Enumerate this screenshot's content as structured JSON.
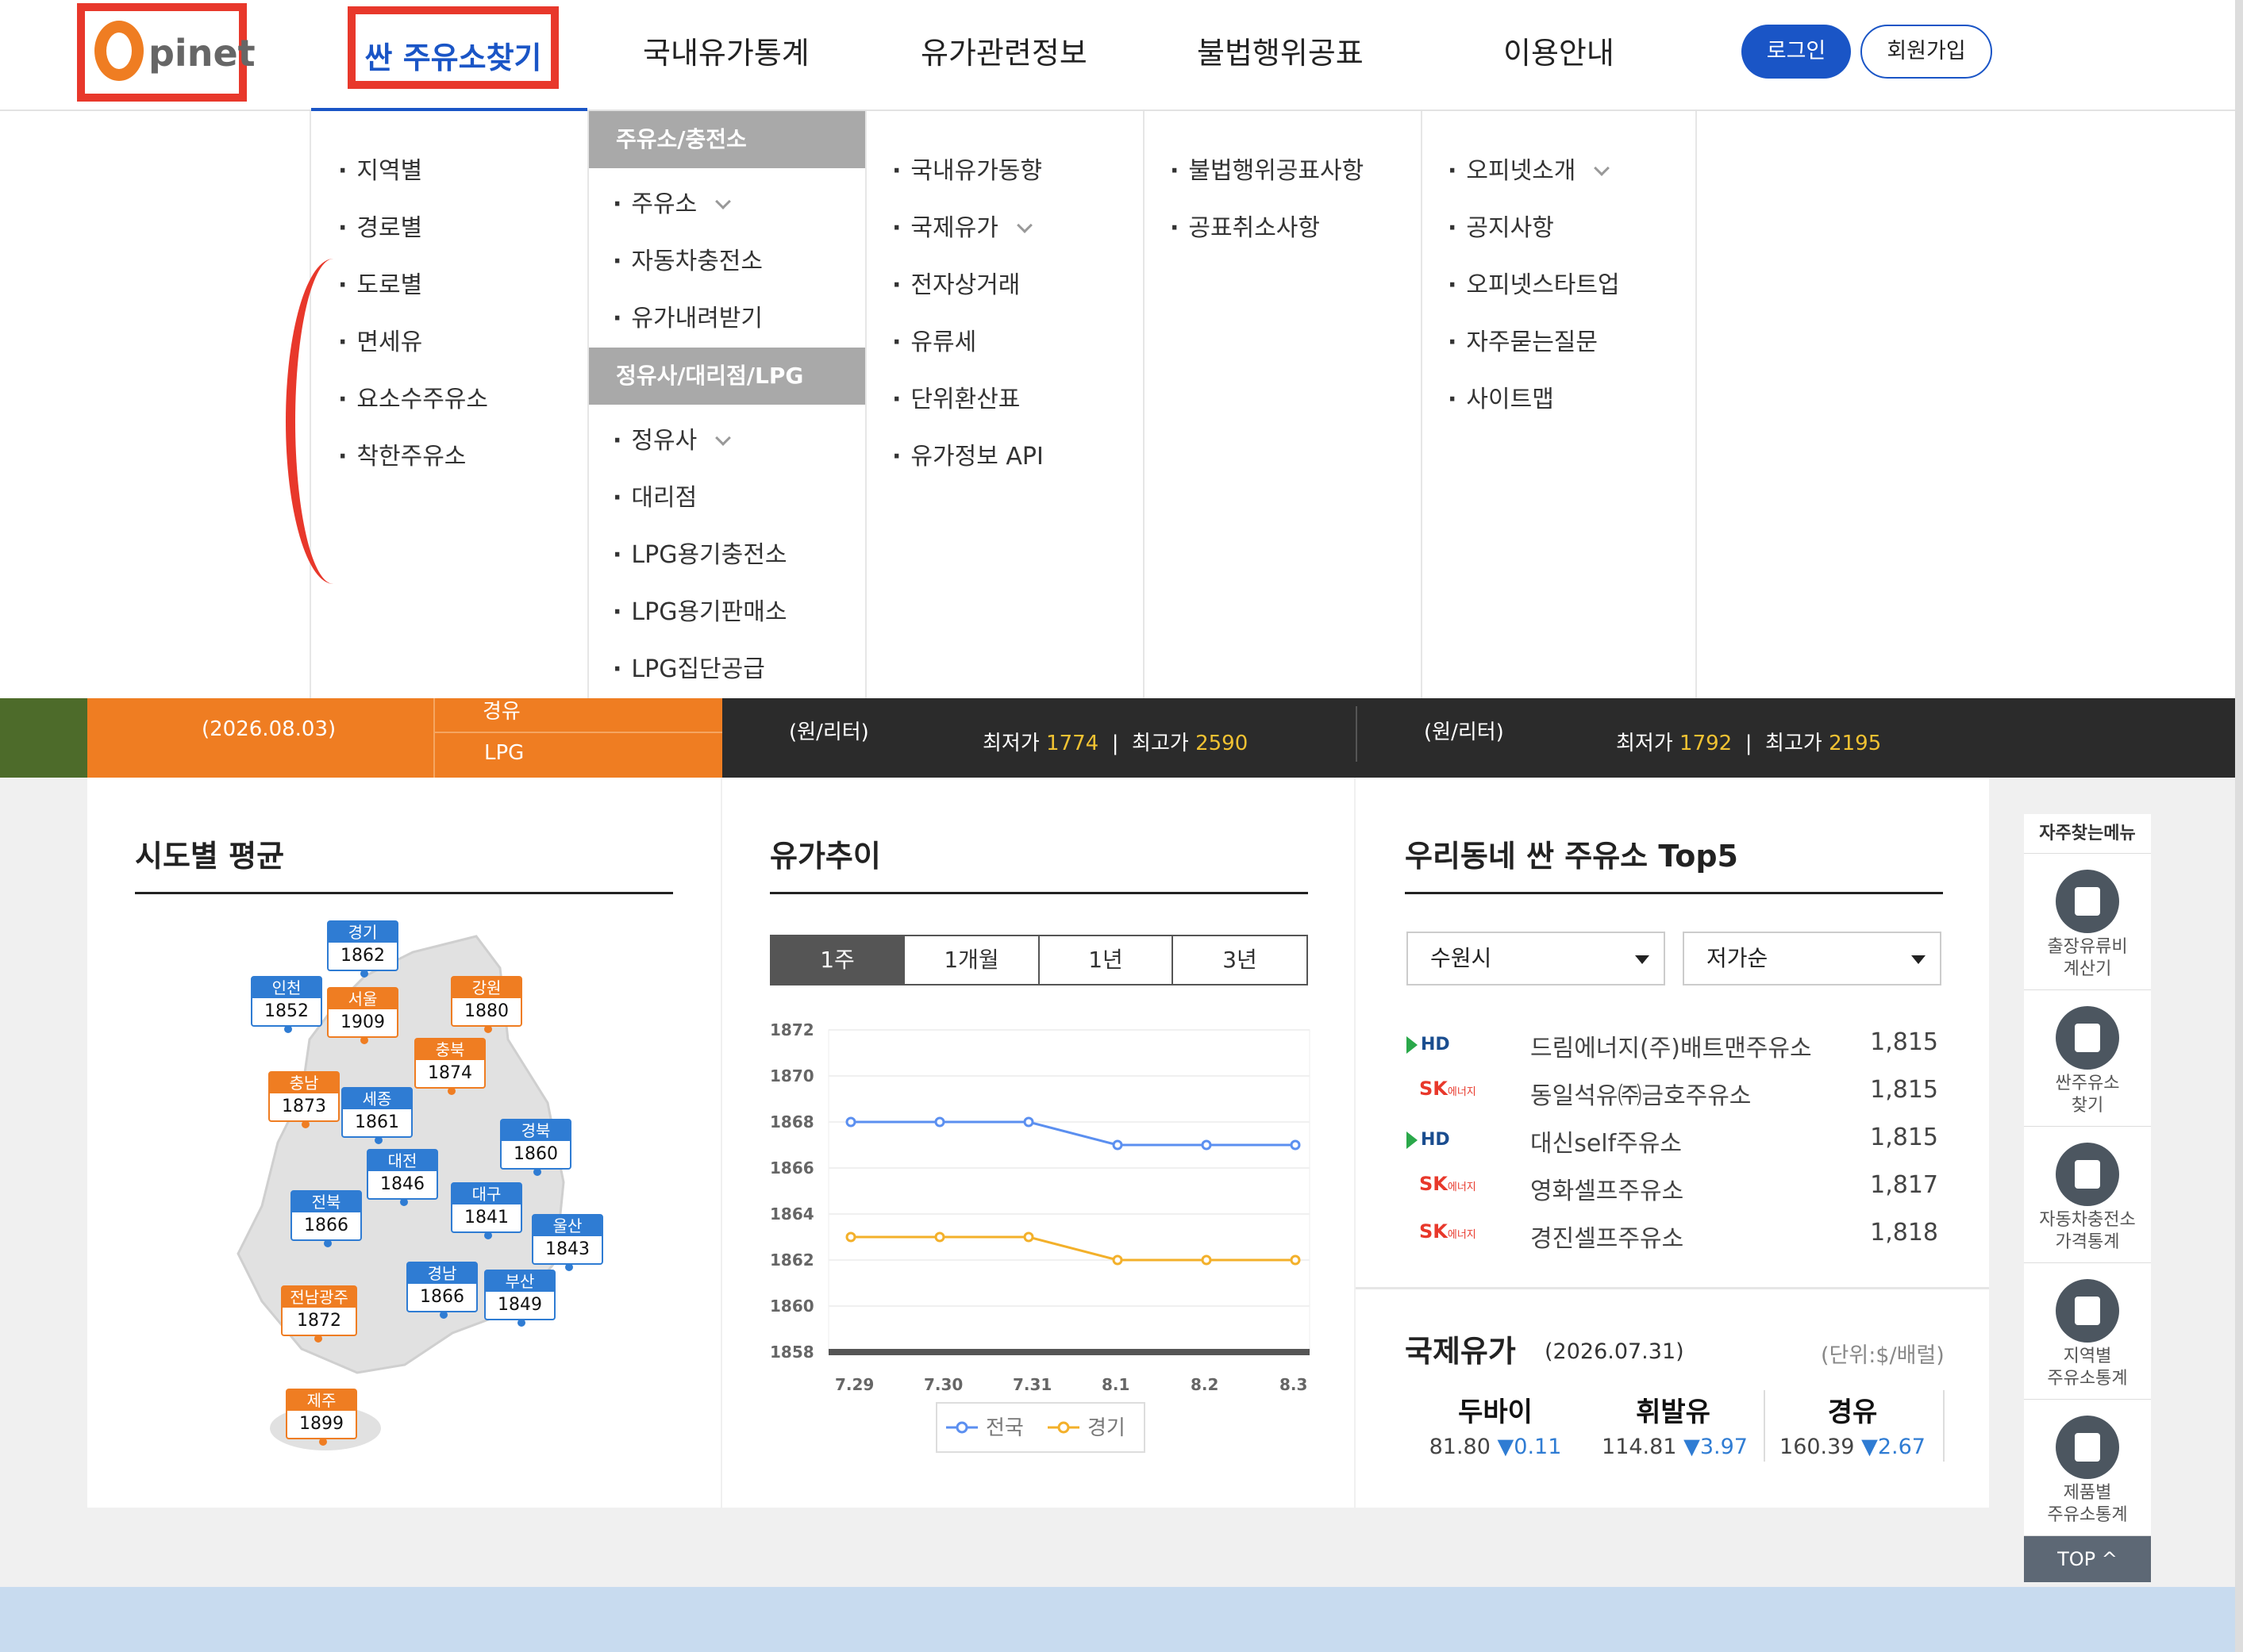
{
  "logo": {
    "letter": "O",
    "text": "pinet"
  },
  "nav": {
    "items": [
      "싼 주유소찾기",
      "국내유가통계",
      "유가관련정보",
      "불법행위공표",
      "이용안내"
    ],
    "login": "로그인",
    "join": "회원가입"
  },
  "menu": {
    "col1": [
      "지역별",
      "경로별",
      "도로별",
      "면세유",
      "요소수주유소",
      "착한주유소"
    ],
    "col2": {
      "head1": "주유소/충전소",
      "group1": [
        "주유소",
        "자동차충전소",
        "유가내려받기"
      ],
      "head2": "정유사/대리점/LPG",
      "group2": [
        "정유사",
        "대리점",
        "LPG용기충전소",
        "LPG용기판매소",
        "LPG집단공급"
      ]
    },
    "col3": [
      "국내유가동향",
      "국제유가",
      "전자상거래",
      "유류세",
      "단위환산표",
      "유가정보 API"
    ],
    "col4": [
      "불법행위공표사항",
      "공표취소사항"
    ],
    "col5": [
      "오피넷소개",
      "공지사항",
      "오피넷스타트업",
      "자주묻는질문",
      "사이트맵"
    ]
  },
  "banner": {
    "date": "(2026.08.03)",
    "fuel_top": "경유",
    "fuel_lpg": "LPG",
    "unit1": "(원/리터)",
    "low_label1": "최저가",
    "low1": "1774",
    "high_label1": "최고가",
    "high1": "2590",
    "unit2": "(원/리터)",
    "low_label2": "최저가",
    "low2": "1792",
    "high_label2": "최고가",
    "high2": "2195"
  },
  "regional": {
    "title": "시도별 평균",
    "regions": [
      {
        "name": "경기",
        "value": "1862",
        "color": "b"
      },
      {
        "name": "인천",
        "value": "1852",
        "color": "b"
      },
      {
        "name": "서울",
        "value": "1909",
        "color": "o"
      },
      {
        "name": "강원",
        "value": "1880",
        "color": "o"
      },
      {
        "name": "충북",
        "value": "1874",
        "color": "o"
      },
      {
        "name": "충남",
        "value": "1873",
        "color": "o"
      },
      {
        "name": "세종",
        "value": "1861",
        "color": "b"
      },
      {
        "name": "경북",
        "value": "1860",
        "color": "b"
      },
      {
        "name": "대전",
        "value": "1846",
        "color": "b"
      },
      {
        "name": "대구",
        "value": "1841",
        "color": "b"
      },
      {
        "name": "전북",
        "value": "1866",
        "color": "b"
      },
      {
        "name": "울산",
        "value": "1843",
        "color": "b"
      },
      {
        "name": "경남",
        "value": "1866",
        "color": "b"
      },
      {
        "name": "부산",
        "value": "1849",
        "color": "b"
      },
      {
        "name": "전남광주",
        "value": "1872",
        "color": "o"
      },
      {
        "name": "제주",
        "value": "1899",
        "color": "o"
      }
    ]
  },
  "trend": {
    "title": "유가추이",
    "tabs": [
      "1주",
      "1개월",
      "1년",
      "3년"
    ],
    "active_tab": "1주"
  },
  "chart_data": {
    "type": "line",
    "x": [
      "7.29",
      "7.30",
      "7.31",
      "8.1",
      "8.2",
      "8.3"
    ],
    "series": [
      {
        "name": "전국",
        "color": "#5b8ff0",
        "values": [
          1868,
          1868,
          1868,
          1867,
          1867,
          1867
        ]
      },
      {
        "name": "경기",
        "color": "#f3b02a",
        "values": [
          1863,
          1863,
          1863,
          1862,
          1862,
          1862
        ]
      }
    ],
    "yticks": [
      "1872",
      "1870",
      "1868",
      "1866",
      "1864",
      "1862",
      "1860",
      "1858"
    ],
    "ylim": [
      1858,
      1872
    ],
    "legend": "bottom"
  },
  "top5": {
    "title": "우리동네 싼 주유소 Top5",
    "city": "수원시",
    "sort": "저가순",
    "stations": [
      {
        "brand": "HD",
        "name": "드림에너지(주)배트맨주유소",
        "price": "1,815"
      },
      {
        "brand": "SK",
        "name": "동일석유㈜금호주유소",
        "price": "1,815"
      },
      {
        "brand": "HD",
        "name": "대신self주유소",
        "price": "1,815"
      },
      {
        "brand": "SK",
        "name": "영화셀프주유소",
        "price": "1,817"
      },
      {
        "brand": "SK",
        "name": "경진셀프주유소",
        "price": "1,818"
      }
    ],
    "brand_hd": "HD",
    "brand_sk": "SK",
    "brand_sk_sub": "에너지"
  },
  "intl": {
    "title": "국제유가",
    "date": "(2026.07.31)",
    "unit": "(단위:$/배럴)",
    "items": [
      {
        "name": "두바이",
        "value": "81.80",
        "change": "▼0.11"
      },
      {
        "name": "휘발유",
        "value": "114.81",
        "change": "▼3.97"
      },
      {
        "name": "경유",
        "value": "160.39",
        "change": "▼2.67"
      }
    ]
  },
  "quick": {
    "head": "자주찾는메뉴",
    "items": [
      {
        "l1": "출장유류비",
        "l2": "계산기"
      },
      {
        "l1": "싼주유소",
        "l2": "찾기"
      },
      {
        "l1": "자동차충전소",
        "l2": "가격통계"
      },
      {
        "l1": "지역별",
        "l2": "주유소통계"
      },
      {
        "l1": "제품별",
        "l2": "주유소통계"
      }
    ],
    "top": "TOP"
  }
}
